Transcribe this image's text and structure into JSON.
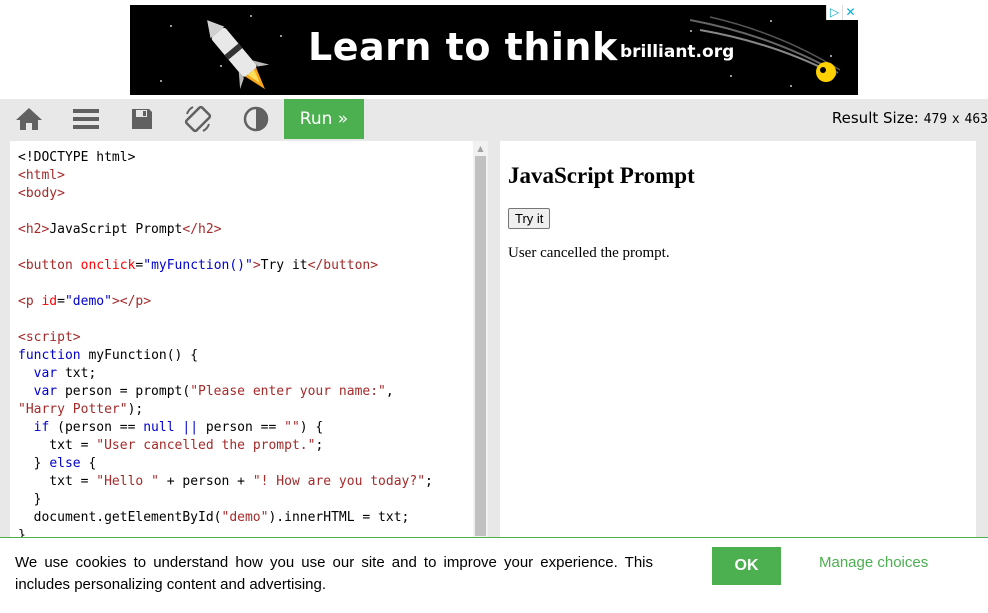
{
  "ad": {
    "headline": "Learn to think",
    "domain": "brilliant.org",
    "badge_adchoices": "▷",
    "badge_close": "✕"
  },
  "toolbar": {
    "icons": [
      "home-icon",
      "menu-icon",
      "save-icon",
      "rotate-icon",
      "contrast-icon"
    ],
    "run_label": "Run »",
    "result_size_label": "Result Size:",
    "result_width": "479",
    "result_x": "x",
    "result_height": "463"
  },
  "editor": {
    "lines": [
      "<!DOCTYPE html>",
      "<html>",
      "<body>",
      "",
      "<h2>JavaScript Prompt</h2>",
      "",
      "<button onclick=\"myFunction()\">Try it</button>",
      "",
      "<p id=\"demo\"></p>",
      "",
      "<script>",
      "function myFunction() {",
      "  var txt;",
      "  var person = prompt(\"Please enter your name:\",",
      "\"Harry Potter\");",
      "  if (person == null || person == \"\") {",
      "    txt = \"User cancelled the prompt.\";",
      "  } else {",
      "    txt = \"Hello \" + person + \"! How are you today?\";",
      "  }",
      "  document.getElementById(\"demo\").innerHTML = txt;",
      "}"
    ]
  },
  "result": {
    "heading": "JavaScript Prompt",
    "button_label": "Try it",
    "demo_text": "User cancelled the prompt."
  },
  "cookie": {
    "text": "We use cookies to understand how you use our site and to improve your experience. This includes personalizing content and advertising.",
    "ok_label": "OK",
    "manage_label": "Manage choices"
  },
  "colors": {
    "accent_green": "#4CAF50",
    "toolbar_bg": "#e8e8e8",
    "icon_gray": "#616161"
  }
}
